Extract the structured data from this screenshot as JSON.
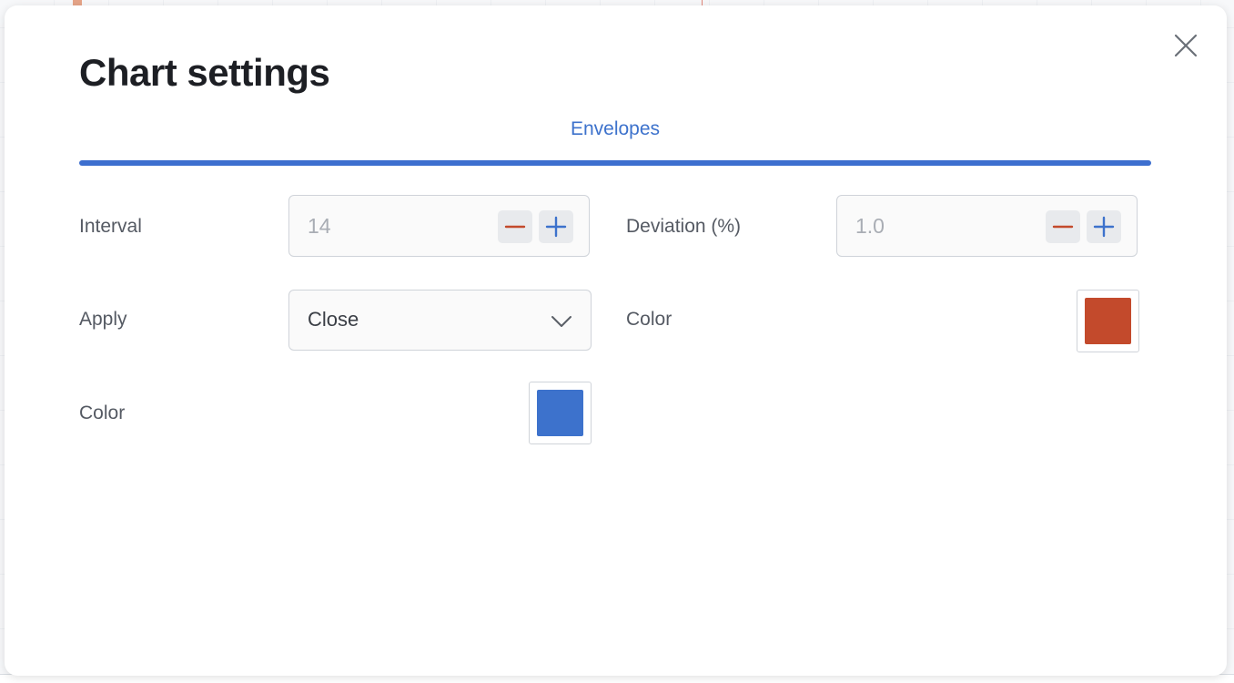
{
  "modal": {
    "title": "Chart settings",
    "close_icon": "close-icon"
  },
  "tabs": [
    {
      "label": "Envelopes",
      "active": true
    }
  ],
  "fields": {
    "interval": {
      "label": "Interval",
      "value": "14"
    },
    "deviation": {
      "label": "Deviation (%)",
      "value": "1.0"
    },
    "apply": {
      "label": "Apply",
      "value": "Close"
    },
    "color_right": {
      "label": "Color",
      "color": "#c34a2c"
    },
    "color_left": {
      "label": "Color",
      "color": "#3d72cc"
    }
  },
  "icons": {
    "minus": "minus-icon",
    "plus": "plus-icon",
    "chevron": "chevron-down-icon"
  },
  "colors": {
    "accent": "#3d6fcf",
    "minus": "#c34a2c",
    "plus": "#3d72cc"
  }
}
